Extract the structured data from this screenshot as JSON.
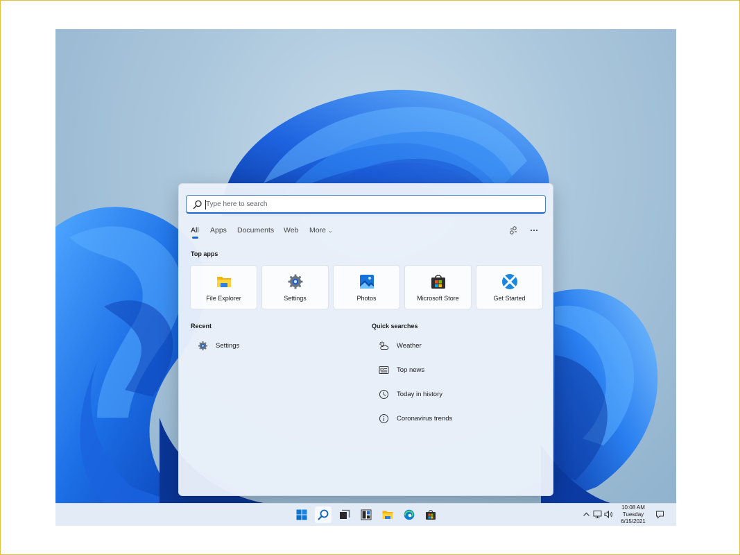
{
  "search": {
    "placeholder": "Type here to search"
  },
  "tabs": [
    {
      "label": "All",
      "active": true
    },
    {
      "label": "Apps",
      "active": false
    },
    {
      "label": "Documents",
      "active": false
    },
    {
      "label": "Web",
      "active": false
    },
    {
      "label": "More",
      "active": false
    }
  ],
  "header_icons": [
    "share-icon",
    "more-options-icon"
  ],
  "top_apps": {
    "title": "Top apps",
    "items": [
      {
        "label": "File Explorer",
        "icon": "file-explorer-icon"
      },
      {
        "label": "Settings",
        "icon": "settings-gear-icon"
      },
      {
        "label": "Photos",
        "icon": "photos-icon"
      },
      {
        "label": "Microsoft Store",
        "icon": "microsoft-store-icon"
      },
      {
        "label": "Get Started",
        "icon": "get-started-icon"
      }
    ]
  },
  "recent": {
    "title": "Recent",
    "items": [
      {
        "label": "Settings",
        "icon": "settings-gear-icon"
      }
    ]
  },
  "quick_searches": {
    "title": "Quick searches",
    "items": [
      {
        "label": "Weather",
        "icon": "weather-icon"
      },
      {
        "label": "Top news",
        "icon": "news-icon"
      },
      {
        "label": "Today in history",
        "icon": "clock-icon"
      },
      {
        "label": "Coronavirus trends",
        "icon": "info-icon"
      }
    ]
  },
  "taskbar": {
    "apps": [
      {
        "name": "start-button",
        "icon": "windows-logo-icon",
        "active": false
      },
      {
        "name": "search-button",
        "icon": "search-icon",
        "active": true
      },
      {
        "name": "task-view-button",
        "icon": "task-view-icon",
        "active": false
      },
      {
        "name": "widgets-button",
        "icon": "widgets-icon",
        "active": false
      },
      {
        "name": "file-explorer-button",
        "icon": "folder-icon",
        "active": false
      },
      {
        "name": "edge-button",
        "icon": "edge-icon",
        "active": false
      },
      {
        "name": "store-button",
        "icon": "store-icon",
        "active": false
      }
    ],
    "tray_icons": [
      "chevron-up-icon",
      "network-icon",
      "volume-icon"
    ],
    "clock": {
      "time": "10:08 AM",
      "day": "Tuesday",
      "date": "6/15/2021"
    },
    "notification_icon": "notification-icon"
  },
  "colors": {
    "accent": "#1a66c8",
    "bloom": "#1f6ee8"
  }
}
